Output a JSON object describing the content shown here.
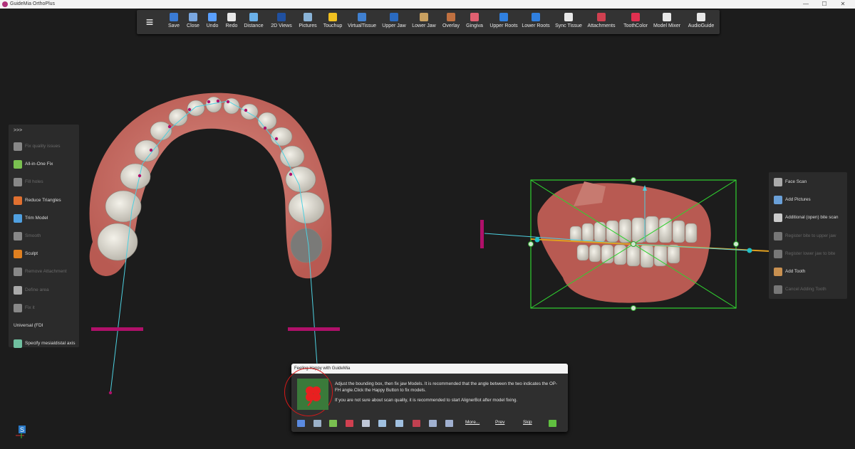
{
  "window": {
    "title": "GuideMia OrthoPlus",
    "minimize": "—",
    "maximize": "☐",
    "close": "✕"
  },
  "toolbar": {
    "menu_icon": "≡",
    "items": [
      {
        "label": "Save",
        "icon": "save-icon",
        "color": "#3a7bd5"
      },
      {
        "label": "Close",
        "icon": "close-file-icon",
        "color": "#7aa7e0"
      },
      {
        "label": "Undo",
        "icon": "undo-icon",
        "color": "#5aa0ff"
      },
      {
        "label": "Redo",
        "icon": "redo-icon",
        "color": "#e8e8e8"
      },
      {
        "label": "Distance",
        "icon": "ruler-icon",
        "color": "#6ab0e8"
      },
      {
        "label": "2D Views",
        "icon": "2d-views-icon",
        "color": "#2050a0"
      },
      {
        "label": "Pictures",
        "icon": "pictures-icon",
        "color": "#8ab4d8"
      },
      {
        "label": "Touchup",
        "icon": "touchup-icon",
        "color": "#f0c020"
      },
      {
        "label": "VirtualTissue",
        "icon": "virtual-tissue-icon",
        "color": "#4080d0"
      },
      {
        "label": "Upper Jaw",
        "icon": "upper-jaw-icon",
        "color": "#2a6ac0"
      },
      {
        "label": "Lower Jaw",
        "icon": "lower-jaw-icon",
        "color": "#c8a060"
      },
      {
        "label": "Overlay",
        "icon": "overlay-icon",
        "color": "#c07040"
      },
      {
        "label": "Gingiva",
        "icon": "gingiva-icon",
        "color": "#e06070"
      },
      {
        "label": "Upper Roots",
        "icon": "upper-roots-icon",
        "color": "#3080e0"
      },
      {
        "label": "Lower Roots",
        "icon": "lower-roots-icon",
        "color": "#3080e0"
      },
      {
        "label": "Sync Tissue",
        "icon": "sync-tissue-icon",
        "color": "#e8e8e8"
      },
      {
        "label": "Attachments",
        "icon": "attachments-icon",
        "color": "#d04050"
      },
      {
        "label": "ToothColor",
        "icon": "tooth-color-icon",
        "color": "#e03050"
      },
      {
        "label": "Model Mixer",
        "icon": "model-mixer-icon",
        "color": "#e8e8e8"
      },
      {
        "label": "AudioGuide",
        "icon": "audio-guide-icon",
        "color": "#e8e8e8"
      }
    ]
  },
  "left_panel": {
    "toggle": ">>>",
    "items": [
      {
        "label": "Fix quality issues",
        "icon": "tools-icon",
        "enabled": false,
        "color": "#888"
      },
      {
        "label": "All-in-One Fix",
        "icon": "all-in-one-fix-icon",
        "enabled": true,
        "color": "#7ac050"
      },
      {
        "label": "Fill holes",
        "icon": "fill-holes-icon",
        "enabled": false,
        "color": "#888"
      },
      {
        "label": "Reduce Triangles",
        "icon": "reduce-triangles-icon",
        "enabled": true,
        "color": "#e07030"
      },
      {
        "label": "Trim Model",
        "icon": "trim-model-icon",
        "enabled": true,
        "color": "#50a0e0"
      },
      {
        "label": "Smooth",
        "icon": "smooth-icon",
        "enabled": false,
        "color": "#888"
      },
      {
        "label": "Sculpt",
        "icon": "sculpt-icon",
        "enabled": true,
        "color": "#e08020"
      },
      {
        "label": "Remove Attachment",
        "icon": "remove-attachment-icon",
        "enabled": false,
        "color": "#888"
      },
      {
        "label": "Define area",
        "icon": "define-area-icon",
        "enabled": false,
        "color": "#aaa"
      },
      {
        "label": "Fix it",
        "icon": "fix-it-icon",
        "enabled": false,
        "color": "#888"
      },
      {
        "label": "Universal (FDI",
        "icon": "dropdown-arrow-icon",
        "enabled": true,
        "color": "#ddd"
      },
      {
        "label": "Specify mesialdistal axis",
        "icon": "mesialdistal-axis-icon",
        "enabled": true,
        "color": "#70c0a0"
      }
    ]
  },
  "right_panel": {
    "items": [
      {
        "label": "Face Scan",
        "icon": "face-scan-icon",
        "enabled": true,
        "color": "#aaa"
      },
      {
        "label": "Add Pictures",
        "icon": "add-pictures-icon",
        "enabled": true,
        "color": "#6aa0d8"
      },
      {
        "label": "Additional (open) bite scan",
        "icon": "bite-scan-icon",
        "enabled": true,
        "color": "#ccc"
      },
      {
        "label": "Register bite to upper jaw",
        "icon": "register-upper-icon",
        "enabled": false,
        "color": "#777"
      },
      {
        "label": "Register lower jaw to bite",
        "icon": "register-lower-icon",
        "enabled": false,
        "color": "#777"
      },
      {
        "label": "Add Tooth",
        "icon": "add-tooth-icon",
        "enabled": true,
        "color": "#c89050"
      },
      {
        "label": "Cancel Adding Tooth",
        "icon": "cancel-add-tooth-icon",
        "enabled": false,
        "color": "#777"
      }
    ]
  },
  "dialog": {
    "title": "Feeling Happy with GuideMia",
    "message_1": "Adjust the bounding box, then fix jaw Models. It is recommended that the angle between the two indicates the OP-FH angle.Click the Happy Button to fix models.",
    "message_2": "If you are not sure about scan quality, it is recommended to start AlignerBot after model fixing.",
    "happy_icon": "clover-icon",
    "links": {
      "more": "More...",
      "prev": "Prev",
      "skip": "Skip"
    },
    "bar_icons": [
      {
        "icon": "menu-lines-icon",
        "color": "#5a8ae0"
      },
      {
        "icon": "panel-icon",
        "color": "#9ab0c8"
      },
      {
        "icon": "tools-icon",
        "color": "#7ac050"
      },
      {
        "icon": "jaw-icon",
        "color": "#d04050"
      },
      {
        "icon": "tooth-icon",
        "color": "#c0c8d8"
      },
      {
        "icon": "search-tooth-icon",
        "color": "#a0c0e0"
      },
      {
        "icon": "screen-icon",
        "color": "#a0c0e0"
      },
      {
        "icon": "attachment-icon",
        "color": "#c04050"
      },
      {
        "icon": "bank-icon",
        "color": "#a0b0d0"
      },
      {
        "icon": "align-icon",
        "color": "#a0b0d0"
      },
      {
        "icon": "camera-icon",
        "color": "#60c040"
      }
    ]
  },
  "logo": {
    "letter": "S"
  }
}
